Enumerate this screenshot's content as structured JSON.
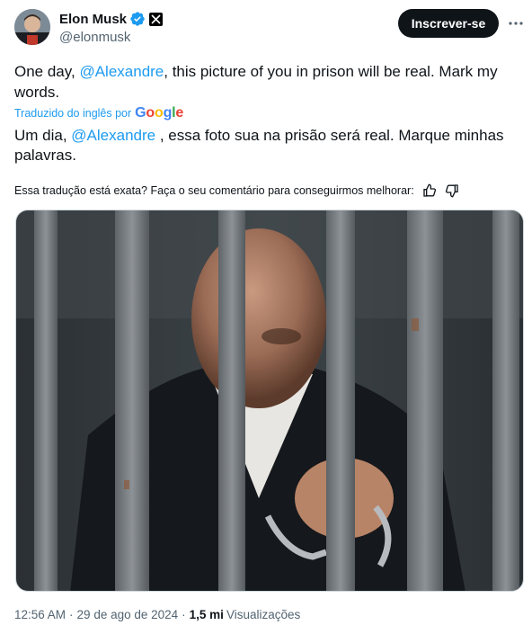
{
  "author": {
    "display_name": "Elon Musk",
    "handle": "@elonmusk",
    "verified_color": "#1d9bf0"
  },
  "actions": {
    "subscribe_label": "Inscrever-se",
    "more_icon": "more-horizontal-icon"
  },
  "tweet": {
    "original": {
      "before": "One day, ",
      "mention": "@Alexandre",
      "after": ", this picture of you in prison will be real. Mark my words."
    },
    "translated_by_label": "Traduzido do inglês por",
    "google": [
      "G",
      "o",
      "o",
      "g",
      "l",
      "e"
    ],
    "translation": {
      "before": "Um dia, ",
      "mention": "@Alexandre",
      "after": " , essa foto sua na prisão será real. Marque minhas palavras."
    },
    "feedback_prompt": "Essa tradução está exata? Faça o seu comentário para conseguirmos melhorar:"
  },
  "footer": {
    "time": "12:56 AM",
    "separator": "·",
    "date": "29 de ago de 2024",
    "separator2": "·",
    "views_count": "1,5 mi",
    "views_label": "Visualizações"
  },
  "colors": {
    "accent": "#1d9bf0",
    "text": "#0f1419",
    "muted": "#536471",
    "button_bg": "#0f1419"
  }
}
